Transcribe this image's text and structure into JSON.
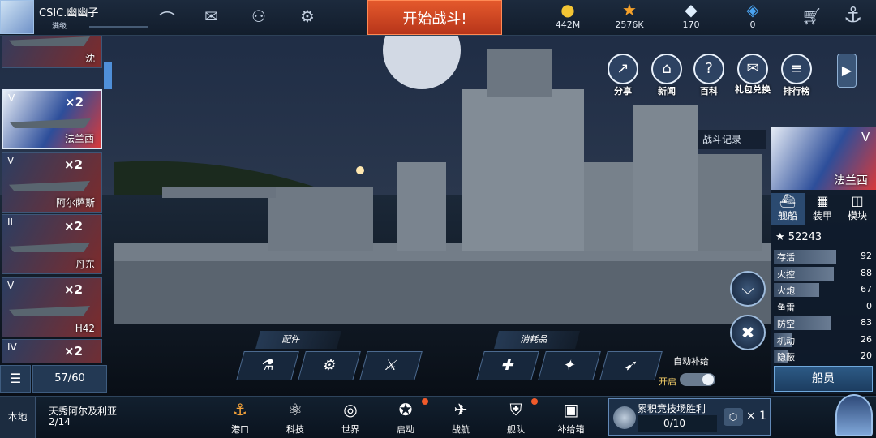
{
  "player": {
    "name": "CSIC.幽幽子",
    "rank": "满级"
  },
  "start_battle": "开始战斗!",
  "resources": [
    {
      "icon": "gold-coin-icon",
      "glyph": "●",
      "value": "442M"
    },
    {
      "icon": "star-icon",
      "glyph": "★",
      "value": "2576K"
    },
    {
      "icon": "diamond-icon",
      "glyph": "◆",
      "value": "170"
    },
    {
      "icon": "blue-gem-icon",
      "glyph": "◈",
      "value": "0"
    }
  ],
  "menu": [
    {
      "label": "分享",
      "glyph": "↗"
    },
    {
      "label": "新闻",
      "glyph": "⌂"
    },
    {
      "label": "百科",
      "glyph": "?"
    },
    {
      "label": "礼包兑换",
      "glyph": "✉"
    },
    {
      "label": "排行榜",
      "glyph": "≡"
    }
  ],
  "ship_list": [
    {
      "tier": "",
      "mult": "",
      "name": "沈"
    },
    {
      "tier": "V",
      "mult": "×2",
      "name": "法兰西"
    },
    {
      "tier": "V",
      "mult": "×2",
      "name": "阿尔萨斯"
    },
    {
      "tier": "II",
      "mult": "×2",
      "name": "丹东"
    },
    {
      "tier": "V",
      "mult": "×2",
      "name": "H42"
    },
    {
      "tier": "IV",
      "mult": "×2",
      "name": ""
    }
  ],
  "ship_count": "57/60",
  "battle_log": "战斗记录",
  "ship": {
    "name": "法兰西",
    "tier": "V",
    "power": "52243"
  },
  "tabs": [
    "舰船",
    "装甲",
    "模块"
  ],
  "stats": [
    {
      "label": "存活",
      "value": "92",
      "pct": 0.92
    },
    {
      "label": "火控",
      "value": "88",
      "pct": 0.88
    },
    {
      "label": "火炮",
      "value": "67",
      "pct": 0.67
    },
    {
      "label": "鱼雷",
      "value": "0",
      "pct": 0.0
    },
    {
      "label": "防空",
      "value": "83",
      "pct": 0.83
    },
    {
      "label": "机动",
      "value": "26",
      "pct": 0.26
    },
    {
      "label": "隐蔽",
      "value": "20",
      "pct": 0.2
    }
  ],
  "crew": "船员",
  "equipment": {
    "parts_label": "配件",
    "consumables_label": "消耗品",
    "auto_supply": "自动补给",
    "auto_on": "开启"
  },
  "local": "本地",
  "mission": {
    "title": "天秀阿尔及利亚",
    "progress": "2/14"
  },
  "nav": [
    {
      "label": "港口",
      "glyph": "⚓"
    },
    {
      "label": "科技",
      "glyph": "⚛"
    },
    {
      "label": "世界",
      "glyph": "◎"
    },
    {
      "label": "启动",
      "glyph": "✪"
    },
    {
      "label": "战航",
      "glyph": "✈"
    },
    {
      "label": "舰队",
      "glyph": "⛨"
    },
    {
      "label": "补给箱",
      "glyph": "▣"
    }
  ],
  "arena": {
    "title": "累积竞技场胜利",
    "progress": "0/10",
    "mult": "× 1"
  }
}
